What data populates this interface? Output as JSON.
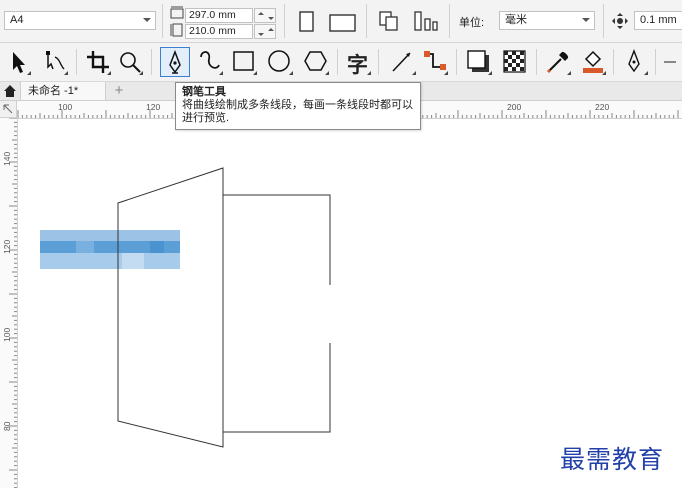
{
  "property_bar": {
    "page_size": "A4",
    "width_value": "297.0 mm",
    "height_value": "210.0 mm",
    "units_label": "单位:",
    "units_value": "毫米",
    "nudge_value": "0.1 mm"
  },
  "tools": [
    {
      "name": "pick-tool",
      "icon": "arrow-pointer-icon"
    },
    {
      "name": "shape-tool",
      "icon": "node-edit-icon"
    },
    {
      "name": "crop-tool",
      "icon": "crop-icon"
    },
    {
      "name": "zoom-tool",
      "icon": "magnifier-icon"
    },
    {
      "name": "pen-tool",
      "icon": "pen-nib-icon",
      "active": true
    },
    {
      "name": "freehand-tool",
      "icon": "curve-icon"
    },
    {
      "name": "rectangle-tool",
      "icon": "rectangle-icon"
    },
    {
      "name": "ellipse-tool",
      "icon": "ellipse-icon"
    },
    {
      "name": "polygon-tool",
      "icon": "polygon-icon"
    },
    {
      "name": "text-tool",
      "icon": "text-icon",
      "glyph": "字"
    },
    {
      "name": "dimension-tool",
      "icon": "parallel-dimension-icon"
    },
    {
      "name": "connector-tool",
      "icon": "connector-icon"
    },
    {
      "name": "drop-shadow-tool",
      "icon": "drop-shadow-icon"
    },
    {
      "name": "transparency-tool",
      "icon": "checkerboard-icon"
    },
    {
      "name": "eyedropper-tool",
      "icon": "eyedropper-icon"
    },
    {
      "name": "interactive-fill-tool",
      "icon": "fill-bucket-icon"
    },
    {
      "name": "smart-fill-tool",
      "icon": "pen-nib-outline-icon"
    }
  ],
  "document": {
    "tab_title": "未命名 -1*",
    "new_tab_glyph": "+"
  },
  "rulers": {
    "horizontal_labels": [
      "100",
      "120",
      "200",
      "220"
    ],
    "vertical_labels": [
      "140",
      "120",
      "100",
      "80"
    ]
  },
  "tooltip": {
    "title": "钢笔工具",
    "description": "将曲线绘制成多条线段，每画一条线段时都可以进行预览."
  },
  "watermark": "最需教育",
  "colors": {
    "accent": "#3b7fd4",
    "blur_blue": "#5b9fd6",
    "watermark": "#2340a8"
  }
}
